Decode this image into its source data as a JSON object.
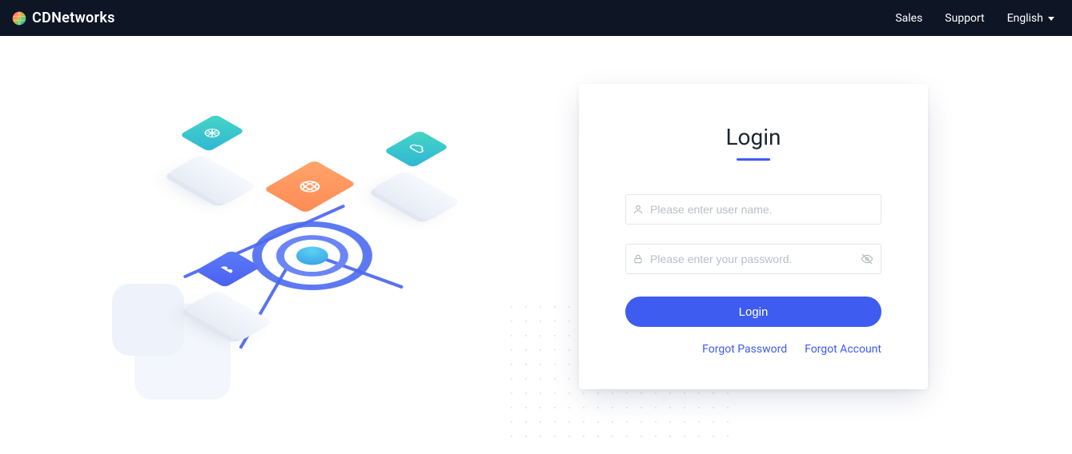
{
  "brand": {
    "name": "CDNetworks"
  },
  "nav": {
    "sales": "Sales",
    "support": "Support",
    "language": "English"
  },
  "login": {
    "title": "Login",
    "username_placeholder": "Please enter user name.",
    "password_placeholder": "Please enter your password.",
    "submit": "Login",
    "forgot_password": "Forgot Password",
    "forgot_account": "Forgot Account"
  },
  "colors": {
    "nav_bg": "#0e1525",
    "primary": "#3e5cf0"
  }
}
